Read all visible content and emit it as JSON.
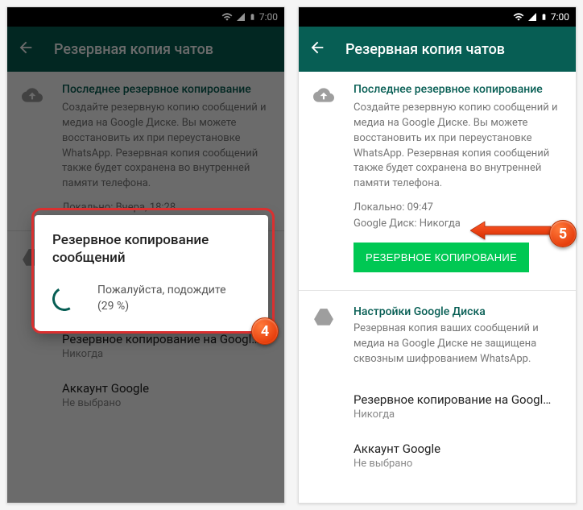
{
  "statusbar": {
    "time": "7:00"
  },
  "appbar": {
    "title": "Резервная копия чатов"
  },
  "section": {
    "title": "Последнее резервное копирование",
    "text": "Создайте резервную копию сообщений и медиа на Google Диске. Вы можете восстановить их при переустановке WhatsApp. Резервная копия сообщений также будет сохранена во внутренней памяти телефона."
  },
  "meta1": {
    "local": "Локально: Вчера, 18:28"
  },
  "meta2": {
    "local": "Локально: 09:47",
    "gdrive": "Google Диск: Никогда"
  },
  "backup_button": "РЕЗЕРВНОЕ КОПИРОВАНИЕ",
  "dialog": {
    "title": "Резервное копирование сообщений",
    "wait": "Пожалуйста, подождите",
    "pct": "(29 %)"
  },
  "gdrive_section": {
    "title": "Настройки Google Диска",
    "text": "Резервная копия ваших сообщений и медиа на Google Диске не защищена сквозным шифрованием WhatsApp."
  },
  "items": {
    "freq": {
      "title": "Резервное копирование на Googl…",
      "sub": "Никогда"
    },
    "account": {
      "title": "Аккаунт Google",
      "sub": "Не выбрано"
    }
  },
  "badges": {
    "b4": "4",
    "b5": "5"
  }
}
